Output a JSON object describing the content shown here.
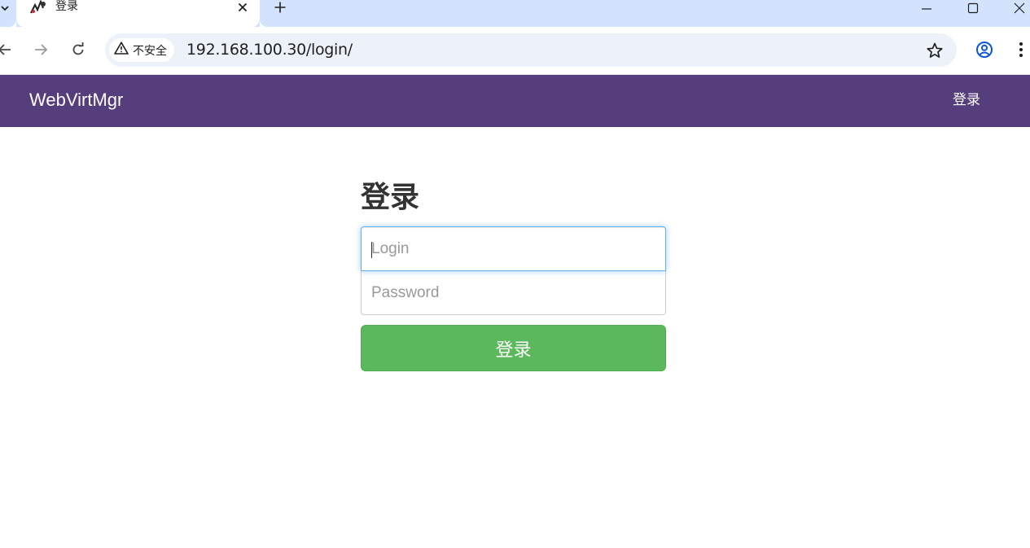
{
  "browser": {
    "tab": {
      "title": "登录",
      "favicon": "webvirtmgr-favicon-icon"
    },
    "security_label": "不安全",
    "url": "192.168.100.30/login/",
    "icons": {
      "tab_menu": "chevron-down-icon",
      "tab_close": "close-icon",
      "new_tab": "plus-icon",
      "minimize": "minimize-icon",
      "maximize": "maximize-icon",
      "close_window": "close-icon",
      "back": "arrow-left-icon",
      "forward": "arrow-right-icon",
      "reload": "reload-icon",
      "warning": "warning-icon",
      "bookmark": "star-icon",
      "profile": "account-circle-icon",
      "menu": "more-vert-icon"
    }
  },
  "navbar": {
    "brand": "WebVirtMgr",
    "login_link": "登录",
    "color": "#563d7c"
  },
  "login_form": {
    "heading": "登录",
    "username_placeholder": "Login",
    "username_value": "",
    "password_placeholder": "Password",
    "password_value": "",
    "submit_label": "登录",
    "submit_color": "#5cb85c"
  }
}
